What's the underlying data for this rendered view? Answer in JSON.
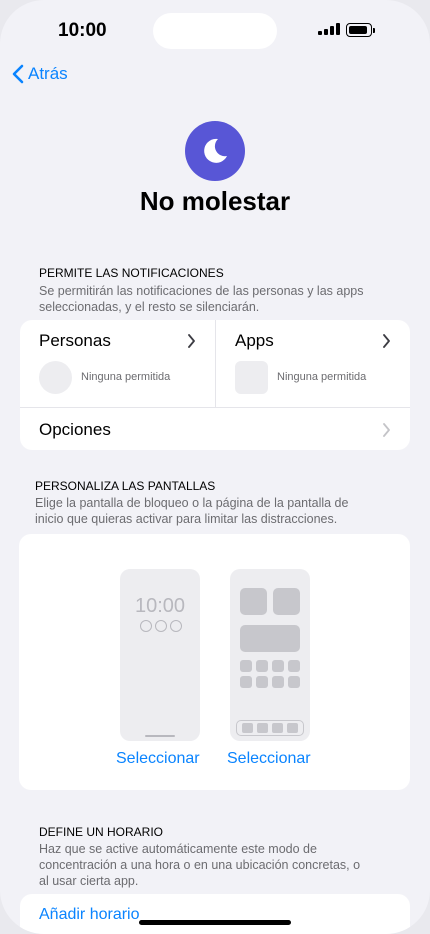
{
  "status": {
    "time": "10:00"
  },
  "nav": {
    "back_label": "Atrás"
  },
  "header": {
    "title": "No molestar",
    "icon": "moon-icon",
    "accent": "#5856d6"
  },
  "notifications": {
    "heading": "PERMITE LAS NOTIFICACIONES",
    "desc_line1": "Se permitirán las notificaciones de las personas y las apps",
    "desc_line2": "seleccionadas, y el resto se silenciarán.",
    "people_label": "Personas",
    "people_status": "Ninguna permitida",
    "apps_label": "Apps",
    "apps_status": "Ninguna permitida",
    "options_label": "Opciones"
  },
  "screens": {
    "heading": "PERSONALIZA LAS PANTALLAS",
    "desc_line1": "Elige la pantalla de bloqueo o la página de la pantalla de",
    "desc_line2": "inicio que quieras activar para limitar las distracciones.",
    "lock_time": "10:00",
    "select_lock": "Seleccionar",
    "select_home": "Seleccionar"
  },
  "schedule": {
    "heading": "DEFINE UN HORARIO",
    "desc_line1": "Haz que se active automáticamente este modo de",
    "desc_line2": "concentración a una hora o en una ubicación concretas, o",
    "desc_line3": "al usar cierta app.",
    "add_label": "Añadir horario"
  },
  "colors": {
    "link": "#0a84ff",
    "background": "#f2f2f7",
    "secondary_text": "#6c6c70"
  }
}
